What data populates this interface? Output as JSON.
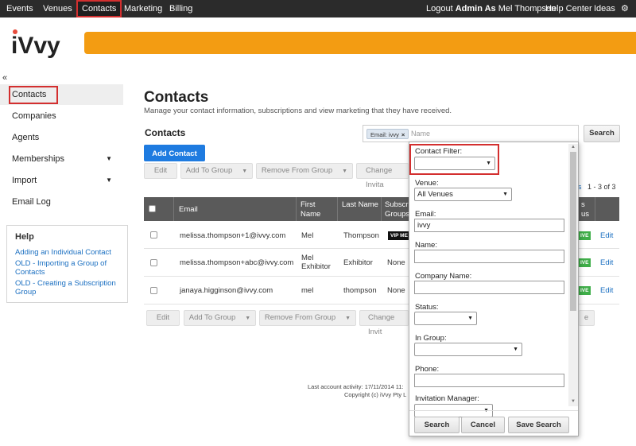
{
  "topnav": {
    "items": [
      "Events",
      "Venues",
      "Contacts",
      "Marketing",
      "Billing"
    ],
    "logout": "Logout",
    "admin_as": "Admin As",
    "user": "Mel Thompson",
    "help_center": "Help Center",
    "ideas": "Ideas",
    "settings_icon": "gear-icon"
  },
  "header": {
    "logo_text": "iVvy",
    "banner_color": "#f39c12"
  },
  "sidebar": {
    "collapse": "«",
    "items": [
      "Contacts",
      "Companies",
      "Agents",
      "Memberships",
      "Import",
      "Email Log"
    ],
    "help": {
      "title": "Help",
      "links": [
        "Adding an Individual Contact",
        "OLD - Importing a Group of Contacts",
        "OLD - Creating a Subscription Group"
      ]
    }
  },
  "main": {
    "title": "Contacts",
    "subtitle": "Manage your contact information, subscriptions and view marketing that they have received.",
    "section_title": "Contacts",
    "search": {
      "chip": "Email: ivvy",
      "placeholder": "Name",
      "button": "Search"
    },
    "add_contact": "Add Contact",
    "toolbar": {
      "edit": "Edit",
      "add_to_group": "Add To Group",
      "remove_from_group": "Remove From Group",
      "change_invite": "Change Invita"
    },
    "toolbar_bottom": {
      "edit": "Edit",
      "add_to_group": "Add To Group",
      "remove_from_group": "Remove From Group",
      "change_invite": "Change Invit",
      "trail": "e"
    },
    "pager_partial": "s",
    "pager": "1 - 3 of 3",
    "columns": {
      "email": "Email",
      "first_name": "First Name",
      "last_name": "Last Name",
      "subscr_1": "Subscr",
      "subscr_2": "Groups",
      "status_1": "s",
      "status_2": "us"
    },
    "rows": [
      {
        "email": "melissa.thompson+1@ivvy.com",
        "first_name": "Mel",
        "last_name": "Thompson",
        "group": "VIP ME",
        "status": "IVE",
        "action": "Edit"
      },
      {
        "email": "melissa.thompson+abc@ivvy.com",
        "first_name": "Mel Exhibitor",
        "last_name": "Exhibitor",
        "group": "None",
        "status": "IVE",
        "action": "Edit"
      },
      {
        "email": "janaya.higginson@ivvy.com",
        "first_name": "mel",
        "last_name": "thompson",
        "group": "None",
        "status": "IVE",
        "action": "Edit"
      }
    ]
  },
  "footer": {
    "activity": "Last account activity: 17/11/2014 11:",
    "copyright": "Copyright (c) iVvy Pty L"
  },
  "filter_panel": {
    "contact_filter_label": "Contact Filter:",
    "contact_filter_value": "",
    "venue_label": "Venue:",
    "venue_value": "All Venues",
    "email_label": "Email:",
    "email_value": "ivvy",
    "name_label": "Name:",
    "name_value": "",
    "company_label": "Company Name:",
    "company_value": "",
    "status_label": "Status:",
    "status_value": "",
    "group_label": "In Group:",
    "group_value": "",
    "phone_label": "Phone:",
    "phone_value": "",
    "manager_label": "Invitation Manager:",
    "manager_value": "",
    "search_btn": "Search",
    "cancel_btn": "Cancel",
    "save_btn": "Save Search"
  }
}
